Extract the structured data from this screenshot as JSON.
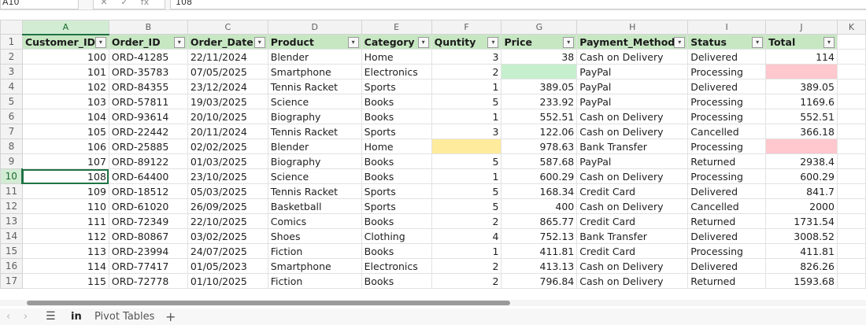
{
  "formula_bar": {
    "cell_ref": "A10",
    "cancel_icon": "✕",
    "enter_icon": "✓",
    "fx_label": "fx",
    "value": "108"
  },
  "columns": [
    "A",
    "B",
    "C",
    "D",
    "E",
    "F",
    "G",
    "H",
    "I",
    "J",
    "K"
  ],
  "selected_column": "A",
  "selected_row": 10,
  "headers": [
    "Customer_ID",
    "Order_ID",
    "Order_Date",
    "Product",
    "Category",
    "Quntity",
    "Price",
    "Payment_Method",
    "Status",
    "Total"
  ],
  "rows": [
    {
      "row": 2,
      "cells": [
        "100",
        "ORD-41285",
        "22/11/2024",
        "Blender",
        "Home",
        "3",
        "38",
        "Cash on Delivery",
        "Delivered",
        "114"
      ]
    },
    {
      "row": 3,
      "cells": [
        "101",
        "ORD-35783",
        "07/05/2025",
        "Smartphone",
        "Electronics",
        "2",
        "",
        "PayPal",
        "Processing",
        ""
      ]
    },
    {
      "row": 4,
      "cells": [
        "102",
        "ORD-84355",
        "23/12/2024",
        "Tennis Racket",
        "Sports",
        "1",
        "389.05",
        "PayPal",
        "Delivered",
        "389.05"
      ]
    },
    {
      "row": 5,
      "cells": [
        "103",
        "ORD-57811",
        "19/03/2025",
        "Science",
        "Books",
        "5",
        "233.92",
        "PayPal",
        "Processing",
        "1169.6"
      ]
    },
    {
      "row": 6,
      "cells": [
        "104",
        "ORD-93614",
        "20/10/2025",
        "Biography",
        "Books",
        "1",
        "552.51",
        "Cash on Delivery",
        "Processing",
        "552.51"
      ]
    },
    {
      "row": 7,
      "cells": [
        "105",
        "ORD-22442",
        "20/11/2024",
        "Tennis Racket",
        "Sports",
        "3",
        "122.06",
        "Cash on Delivery",
        "Cancelled",
        "366.18"
      ]
    },
    {
      "row": 8,
      "cells": [
        "106",
        "ORD-25885",
        "02/02/2025",
        "Blender",
        "Home",
        "",
        "978.63",
        "Bank Transfer",
        "Processing",
        ""
      ]
    },
    {
      "row": 9,
      "cells": [
        "107",
        "ORD-89122",
        "01/03/2025",
        "Biography",
        "Books",
        "5",
        "587.68",
        "PayPal",
        "Returned",
        "2938.4"
      ]
    },
    {
      "row": 10,
      "cells": [
        "108",
        "ORD-64400",
        "23/10/2025",
        "Science",
        "Books",
        "1",
        "600.29",
        "Cash on Delivery",
        "Processing",
        "600.29"
      ]
    },
    {
      "row": 11,
      "cells": [
        "109",
        "ORD-18512",
        "05/03/2025",
        "Tennis Racket",
        "Sports",
        "5",
        "168.34",
        "Credit Card",
        "Delivered",
        "841.7"
      ]
    },
    {
      "row": 12,
      "cells": [
        "110",
        "ORD-61020",
        "26/09/2025",
        "Basketball",
        "Sports",
        "5",
        "400",
        "Cash on Delivery",
        "Cancelled",
        "2000"
      ]
    },
    {
      "row": 13,
      "cells": [
        "111",
        "ORD-72349",
        "22/10/2025",
        "Comics",
        "Books",
        "2",
        "865.77",
        "Credit Card",
        "Returned",
        "1731.54"
      ]
    },
    {
      "row": 14,
      "cells": [
        "112",
        "ORD-80867",
        "03/02/2025",
        "Shoes",
        "Clothing",
        "4",
        "752.13",
        "Bank Transfer",
        "Delivered",
        "3008.52"
      ]
    },
    {
      "row": 15,
      "cells": [
        "113",
        "ORD-23994",
        "24/07/2025",
        "Fiction",
        "Books",
        "1",
        "411.81",
        "Credit Card",
        "Processing",
        "411.81"
      ]
    },
    {
      "row": 16,
      "cells": [
        "114",
        "ORD-77417",
        "01/05/2023",
        "Smartphone",
        "Electronics",
        "2",
        "413.13",
        "Cash on Delivery",
        "Delivered",
        "826.26"
      ]
    },
    {
      "row": 17,
      "cells": [
        "115",
        "ORD-72778",
        "01/10/2025",
        "Fiction",
        "Books",
        "2",
        "796.84",
        "Cash on Delivery",
        "Returned",
        "1593.68"
      ]
    }
  ],
  "highlights": [
    {
      "row": 3,
      "col": 6,
      "color": "#c6efce"
    },
    {
      "row": 3,
      "col": 9,
      "color": "#ffc7ce"
    },
    {
      "row": 8,
      "col": 5,
      "color": "#ffeb9c"
    },
    {
      "row": 8,
      "col": 9,
      "color": "#ffc7ce"
    }
  ],
  "sheet_tabs": {
    "menu_icon": "☰",
    "prev_icon": "‹",
    "next_icon": "›",
    "active": "in",
    "other": "Pivot Tables",
    "add_icon": "+"
  },
  "colors": {
    "header_fill": "#c7e7c3",
    "selection": "#217346"
  }
}
